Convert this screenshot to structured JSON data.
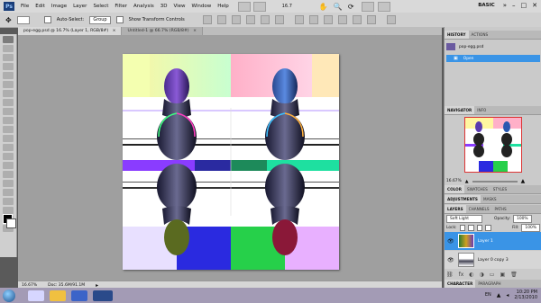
{
  "menubar": {
    "logo": "Ps",
    "items": [
      "File",
      "Edit",
      "Image",
      "Layer",
      "Select",
      "Filter",
      "Analysis",
      "3D",
      "View",
      "Window",
      "Help"
    ],
    "zoom": "16.7",
    "workspace": "BASIC"
  },
  "options": {
    "auto_select_label": "Auto-Select:",
    "auto_select_value": "Group",
    "transform_label": "Show Transform Controls"
  },
  "tabs": [
    {
      "label": "pop-egg.psd @ 16.7% (Layer 1, RGB/8#)"
    },
    {
      "label": "Untitled-1 @ 66.7% (RGB/8#)"
    }
  ],
  "status": {
    "zoom": "16.67%",
    "doc": "Doc: 35.6M/91.1M"
  },
  "history": {
    "tabs": [
      "HISTORY",
      "ACTIONS"
    ],
    "doc_name": "pop-egg.psd",
    "step": "Open"
  },
  "navigator": {
    "tabs": [
      "NAVIGATOR",
      "INFO"
    ],
    "zoom": "16.67%"
  },
  "color_tabs": [
    "COLOR",
    "SWATCHES",
    "STYLES"
  ],
  "adjust_tabs": [
    "ADJUSTMENTS",
    "MASKS"
  ],
  "layers": {
    "tabs": [
      "LAYERS",
      "CHANNELS",
      "PATHS"
    ],
    "blend": "Soft Light",
    "opacity_label": "Opacity:",
    "opacity": "100%",
    "lock_label": "Lock:",
    "fill_label": "Fill:",
    "fill": "100%",
    "items": [
      {
        "name": "Layer 1"
      },
      {
        "name": "Layer 0 copy 3"
      }
    ]
  },
  "char_tabs": [
    "CHARACTER",
    "PARAGRAPH"
  ],
  "taskbar": {
    "lang": "EN",
    "time": "10:20 PM",
    "date": "2/13/2010"
  },
  "colors": {
    "accent": "#3c8de0",
    "selected_row": "#3a94e6"
  }
}
